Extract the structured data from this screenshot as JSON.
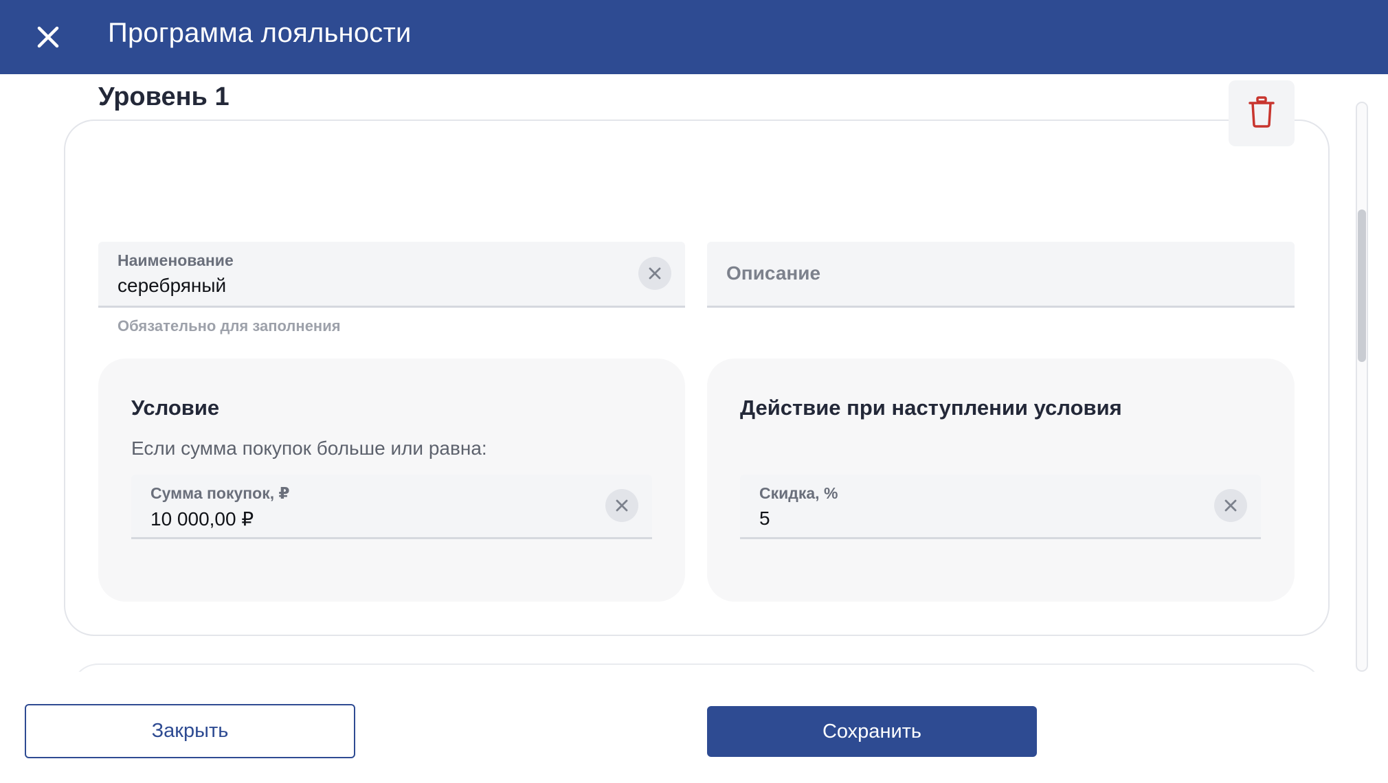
{
  "header": {
    "title": "Программа лояльности",
    "close_icon": "close-icon"
  },
  "level": {
    "title": "Уровень 1",
    "delete_icon": "trash-icon",
    "delete_color": "#c8352e",
    "name_field": {
      "label": "Наименование",
      "value": "серебряный",
      "hint": "Обязательно для заполнения"
    },
    "description_field": {
      "placeholder": "Описание"
    },
    "condition": {
      "title": "Условие",
      "text": "Если сумма покупок больше или равна:",
      "field_label": "Сумма покупок, ₽",
      "field_value": "10 000,00 ₽"
    },
    "action": {
      "title": "Действие при наступлении условия",
      "field_label": "Скидка, %",
      "field_value": "5"
    }
  },
  "footer": {
    "close_label": "Закрыть",
    "save_label": "Сохранить"
  },
  "colors": {
    "brand": "#2e4b92",
    "field_bg": "#f4f5f7",
    "panel_bg": "#f7f7f8"
  }
}
